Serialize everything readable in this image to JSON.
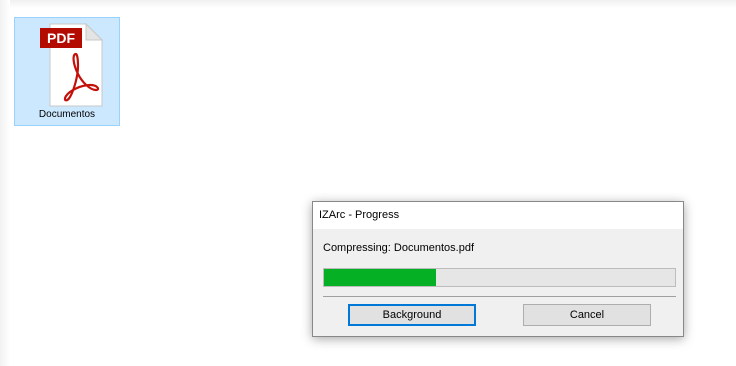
{
  "desktop": {
    "file": {
      "label": "Documentos",
      "icon": "pdf-file-icon",
      "badge_text": "PDF"
    }
  },
  "dialog": {
    "title": "IZArc - Progress",
    "status": "Compressing: Documentos.pdf",
    "progress": 0.32,
    "buttons": {
      "background": "Background",
      "cancel": "Cancel"
    }
  },
  "colors": {
    "progress_fill": "#06b025",
    "selection": "#cce8ff",
    "pdf_red": "#b30b00",
    "default_button_border": "#0078d7"
  }
}
